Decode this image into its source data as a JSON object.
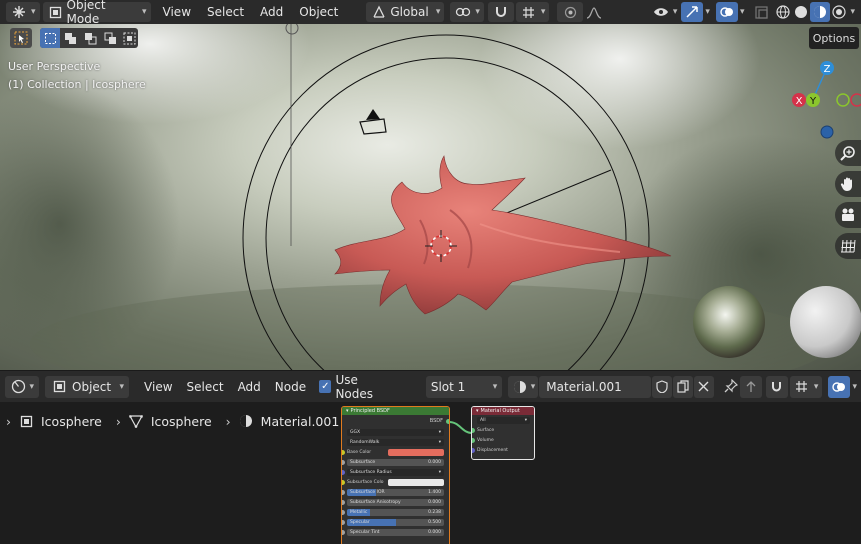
{
  "topbar": {
    "mode": "Object Mode",
    "menus": [
      "View",
      "Select",
      "Add",
      "Object"
    ],
    "orientation": "Global"
  },
  "viewport": {
    "perspective_label": "User Perspective",
    "collection_label": "(1) Collection | Icosphere",
    "options_label": "Options",
    "gizmo_axes": {
      "z": "Z",
      "x": "X",
      "y": "Y"
    }
  },
  "node_header": {
    "editor_type": "Object",
    "menus": [
      "View",
      "Select",
      "Add",
      "Node"
    ],
    "use_nodes_label": "Use Nodes",
    "slot": "Slot 1",
    "material_name": "Material.001"
  },
  "breadcrumb": {
    "object": "Icosphere",
    "mesh": "Icosphere",
    "material": "Material.001"
  },
  "bsdf_node": {
    "title": "Principled BSDF",
    "output": "BSDF",
    "distribution": "GGX",
    "subsurface_method": "RandomWalk",
    "rows": [
      {
        "label": "Base Color",
        "value": ""
      },
      {
        "label": "Subsurface",
        "value": "0.000"
      },
      {
        "label": "Subsurface Radius",
        "value": ""
      },
      {
        "label": "Subsurface Colo",
        "value": ""
      },
      {
        "label": "Subsurface IOR",
        "value": "1.400"
      },
      {
        "label": "Subsurface Anisotropy",
        "value": "0.000"
      },
      {
        "label": "Metallic",
        "value": "0.238"
      },
      {
        "label": "Specular",
        "value": "0.500"
      },
      {
        "label": "Specular Tint",
        "value": "0.000"
      }
    ]
  },
  "output_node": {
    "title": "Material Output",
    "target": "All",
    "inputs": [
      "Surface",
      "Volume",
      "Displacement"
    ]
  },
  "colors": {
    "accent": "#4772b3",
    "bsdf_header": "#3b7a34",
    "output_header": "#7a2b37",
    "base_color": "#e46d5e",
    "gizmo_z": "#2e8ed8",
    "gizmo_x": "#d5324a",
    "gizmo_y": "#8bc62d"
  }
}
